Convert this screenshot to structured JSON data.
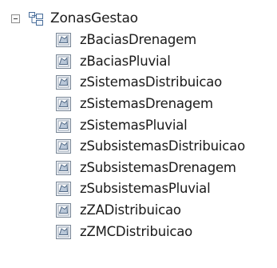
{
  "tree": {
    "root": {
      "label": "ZonasGestao",
      "expander_icon": "collapse-minus",
      "icon": "feature-dataset-icon",
      "expanded": true
    },
    "children": [
      {
        "label": "zBaciasDrenagem",
        "icon": "polygon-feature-class-icon"
      },
      {
        "label": "zBaciasPluvial",
        "icon": "polygon-feature-class-icon"
      },
      {
        "label": "zSistemasDistribuicao",
        "icon": "polygon-feature-class-icon"
      },
      {
        "label": "zSistemasDrenagem",
        "icon": "polygon-feature-class-icon"
      },
      {
        "label": "zSistemasPluvial",
        "icon": "polygon-feature-class-icon"
      },
      {
        "label": "zSubsistemasDistribuicao",
        "icon": "polygon-feature-class-icon"
      },
      {
        "label": "zSubsistemasDrenagem",
        "icon": "polygon-feature-class-icon"
      },
      {
        "label": "zSubsistemasPluvial",
        "icon": "polygon-feature-class-icon"
      },
      {
        "label": "zZADistribuicao",
        "icon": "polygon-feature-class-icon"
      },
      {
        "label": "zZMCDistribuicao",
        "icon": "polygon-feature-class-icon"
      }
    ]
  }
}
